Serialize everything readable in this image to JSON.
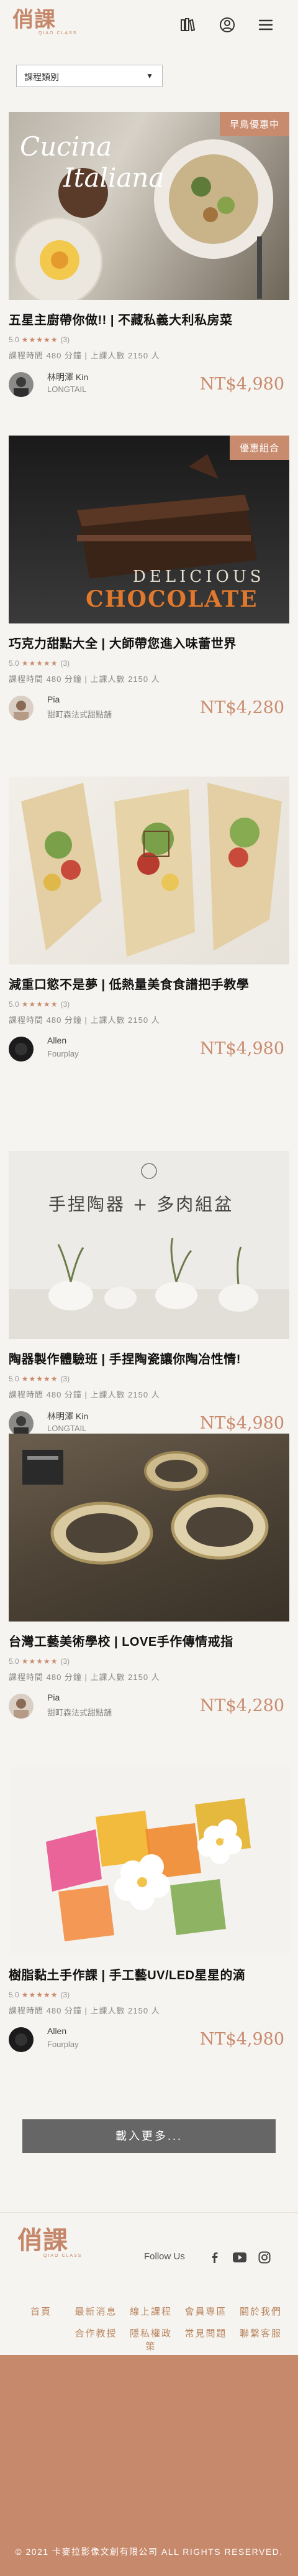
{
  "header": {
    "logo_text": "俏課",
    "logo_sub": "QIAO CLASS",
    "icons": [
      "books-icon",
      "user-icon",
      "menu-icon"
    ]
  },
  "filter": {
    "label": "課程類別"
  },
  "rating_label": "5.0",
  "rating_count": "(3)",
  "stars": "★★★★★",
  "cards": [
    {
      "badge": "早鳥優惠中",
      "title": "五星主廚帶你做!! | 不藏私義大利私房菜",
      "meta": "課程時間 480 分鐘 | 上課人數 2150 人",
      "teacher": "林明澤 Kin",
      "org": "LONGTAIL",
      "price": "NT$4,980",
      "image_text_1": "Cucina",
      "image_text_2": "Italiana"
    },
    {
      "badge": "優惠組合",
      "title": "巧克力甜點大全 | 大師帶您進入味蕾世界",
      "meta": "課程時間 480 分鐘 | 上課人數 2150 人",
      "teacher": "Pia",
      "org": "甜町森法式甜點舖",
      "price": "NT$4,280",
      "image_text_1": "DELICIOUS",
      "image_text_2": "CHOCOLATE"
    },
    {
      "badge": "",
      "title": "減重口慾不是夢 | 低熱量美食食譜把手教學",
      "meta": "課程時間 480 分鐘 | 上課人數 2150 人",
      "teacher": "Allen",
      "org": "Fourplay",
      "price": "NT$4,980",
      "image_text_1": "",
      "image_text_2": ""
    },
    {
      "badge": "",
      "title": "陶器製作體驗班 | 手捏陶瓷讓你陶冶性情!",
      "meta": "課程時間 480 分鐘 | 上課人數 2150 人",
      "teacher": "林明澤 Kin",
      "org": "LONGTAIL",
      "price": "NT$4,980",
      "image_text_1": "手捏陶器 + 多肉組盆",
      "image_text_2": ""
    },
    {
      "badge": "",
      "title": "台灣工藝美術學校 | LOVE手作傳情戒指",
      "meta": "課程時間 480 分鐘 | 上課人數 2150 人",
      "teacher": "Pia",
      "org": "甜町森法式甜點舖",
      "price": "NT$4,280",
      "image_text_1": "",
      "image_text_2": ""
    },
    {
      "badge": "",
      "title": "樹脂黏土手作課 | 手工藝UV/LED星星的滴",
      "meta": "課程時間 480 分鐘 | 上課人數 2150 人",
      "teacher": "Allen",
      "org": "Fourplay",
      "price": "NT$4,980",
      "image_text_1": "",
      "image_text_2": ""
    }
  ],
  "load_more": "載入更多...",
  "footer": {
    "logo_text": "俏課",
    "logo_sub": "QIAO CLASS",
    "follow": "Follow Us",
    "links_row1": [
      "首頁",
      "最新消息",
      "線上課程",
      "會員專區",
      "關於我們"
    ],
    "links_row2": [
      "",
      "合作教授",
      "隱私權政策",
      "常見問題",
      "聯繫客服"
    ],
    "copyright": "© 2021 卡麥拉影像文創有限公司 ALL RIGHTS RESERVED."
  },
  "colors": {
    "accent": "#c98b6e",
    "bg": "#f6f4f0",
    "copy_band": "#c7896b"
  }
}
